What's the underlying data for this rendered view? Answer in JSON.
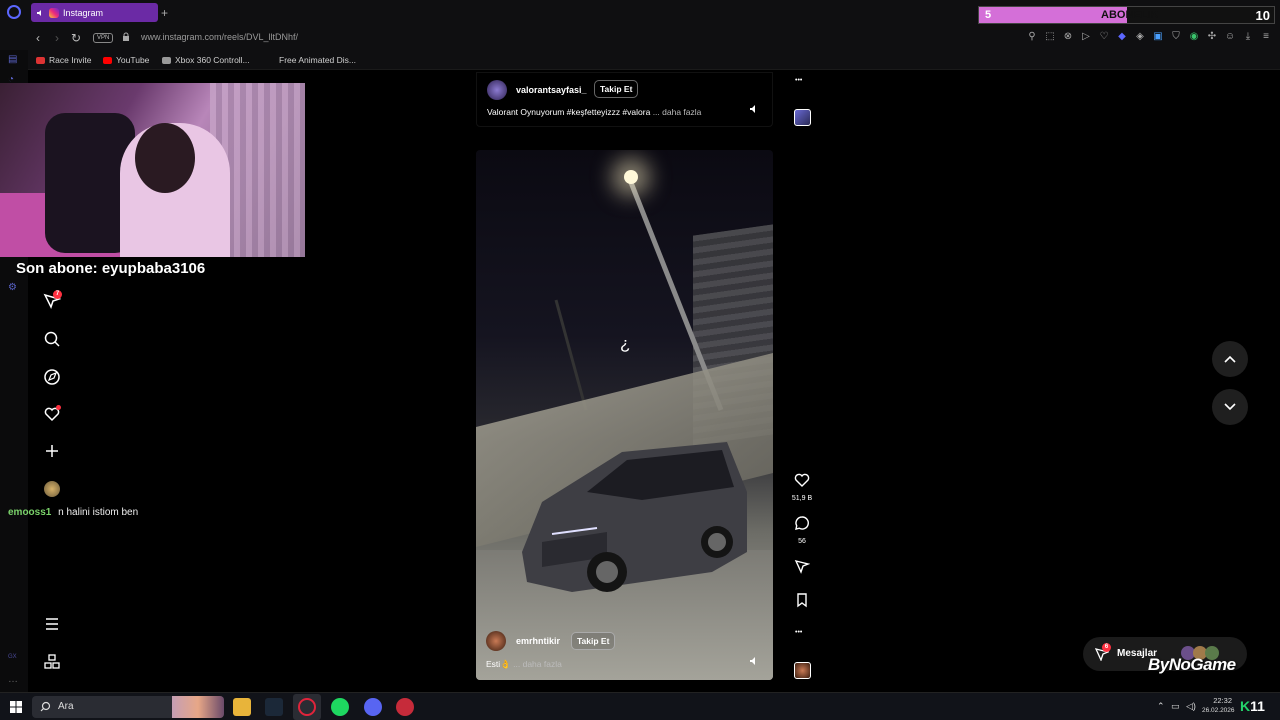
{
  "browser": {
    "tab_title": "Instagram",
    "new_tab_label": "+",
    "url": "www.instagram.com/reels/DVL_lltDNhf/",
    "vpn_label": "VPN",
    "bookmarks": [
      "Race Invite",
      "YouTube",
      "Xbox 360 Controll...",
      "Free Animated Dis..."
    ]
  },
  "subscription_widget": {
    "current": "5",
    "title": "ABONELIK",
    "goal": "10",
    "progress": 0.5,
    "fill_color": "#d46fd8"
  },
  "stream_overlay": {
    "last_sub_text": "Son abone: eyupbaba3106",
    "chat": {
      "user": "emooss1",
      "message": "n halini istiom ben",
      "user_color": "#7bd36b"
    }
  },
  "ig_nav": {
    "reels_badge": "7",
    "icons": [
      "reels-icon",
      "search-icon",
      "explore-icon",
      "notifications-icon",
      "create-icon",
      "profile-avatar",
      "more-menu-icon",
      "also-from-meta-icon"
    ]
  },
  "reels": [
    {
      "username": "valorantsayfasi_",
      "follow_label": "Takip Et",
      "caption": "Valorant Oynuyorum #keşfetteyizzz #valora",
      "more_label": "... daha fazla"
    },
    {
      "username": "emrhntikir",
      "follow_label": "Takip Et",
      "caption": "Esti👌",
      "more_label": "... daha fazla",
      "likes": "51,9 B",
      "comments": "56",
      "cursor_glyph": "¿"
    }
  ],
  "more_dots": "•••",
  "messages_widget": {
    "label": "Mesajlar",
    "badge": "6"
  },
  "watermark": "ByNoGame",
  "taskbar": {
    "search_label": "Ara",
    "time": "22:32",
    "date": "26.02.2026",
    "k11_k": "K",
    "k11_num": "11"
  },
  "colors": {
    "accent": "#6b2aa5",
    "ig_red": "#ff3040",
    "background": "#000000"
  }
}
